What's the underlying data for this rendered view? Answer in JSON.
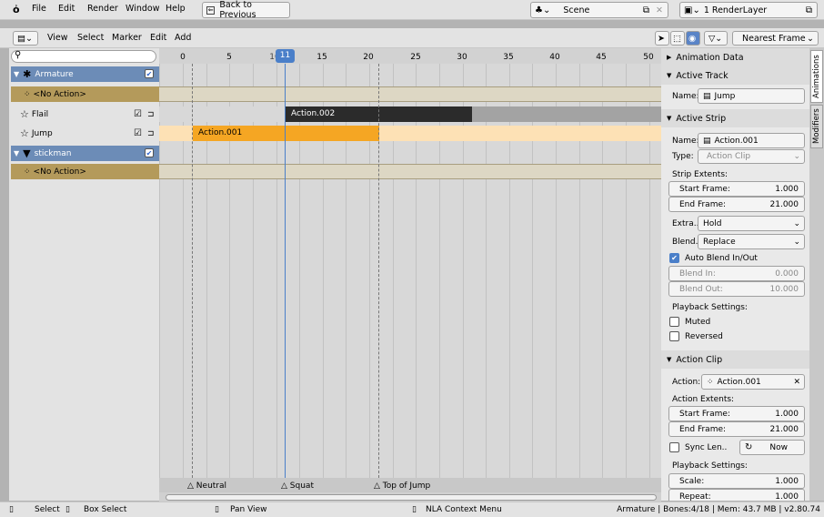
{
  "menubar": {
    "items": [
      "File",
      "Edit",
      "Render",
      "Window",
      "Help"
    ],
    "back_button": "Back to Previous",
    "scene": "Scene",
    "render_layer": "1 RenderLayer"
  },
  "header": {
    "items": [
      "View",
      "Select",
      "Marker",
      "Edit",
      "Add"
    ],
    "snap_mode": "Nearest Frame"
  },
  "timeline": {
    "ticks": [
      "0",
      "5",
      "10",
      "15",
      "20",
      "25",
      "30",
      "35",
      "40",
      "45",
      "50"
    ],
    "current_frame": "11",
    "strips": {
      "flail": "Action.002",
      "jump": "Action.001"
    },
    "markers": [
      "Neutral",
      "Squat",
      "Top of Jump"
    ]
  },
  "channels": [
    {
      "label": "Armature",
      "kind": "object"
    },
    {
      "label": "<No Action>",
      "kind": "action"
    },
    {
      "label": "Flail",
      "kind": "track"
    },
    {
      "label": "Jump",
      "kind": "track"
    },
    {
      "label": "stickman",
      "kind": "object"
    },
    {
      "label": "<No Action>",
      "kind": "action"
    }
  ],
  "sidebar": {
    "animation_data": "Animation Data",
    "active_track": {
      "title": "Active Track",
      "name_label": "Name:",
      "name": "Jump"
    },
    "active_strip": {
      "title": "Active Strip",
      "name_label": "Name:",
      "name": "Action.001",
      "type_label": "Type:",
      "type": "Action Clip",
      "extents_label": "Strip Extents:",
      "start_label": "Start Frame:",
      "start": "1.000",
      "end_label": "End Frame:",
      "end": "21.000",
      "extra_label": "Extra..",
      "extra": "Hold",
      "blend_label": "Blend..",
      "blend": "Replace",
      "auto_blend": "Auto Blend In/Out",
      "blend_in_label": "Blend In:",
      "blend_in": "0.000",
      "blend_out_label": "Blend Out:",
      "blend_out": "10.000",
      "playback_label": "Playback Settings:",
      "muted": "Muted",
      "reversed": "Reversed"
    },
    "action_clip": {
      "title": "Action Clip",
      "action_label": "Action:",
      "action": "Action.001",
      "extents_label": "Action Extents:",
      "start_label": "Start Frame:",
      "start": "1.000",
      "end_label": "End Frame:",
      "end": "21.000",
      "sync_label": "Sync Len..",
      "now": "Now",
      "playback_label": "Playback Settings:",
      "scale_label": "Scale:",
      "scale": "1.000",
      "repeat_label": "Repeat:",
      "repeat": "1.000"
    },
    "tabs": [
      "Animations",
      "Modifiers"
    ]
  },
  "statusbar": {
    "select": "Select",
    "box_select": "Box Select",
    "pan_view": "Pan View",
    "context_menu": "NLA Context Menu",
    "info": "Armature | Bones:4/18 | Mem: 43.7 MB | v2.80.74"
  },
  "colors": {
    "object_row": "#6c8cb7",
    "action_row": "#b49a5b",
    "active_strip": "#f5a623",
    "inactive_strip": "#2b2b2b",
    "current_frame": "#4a7fc9"
  }
}
